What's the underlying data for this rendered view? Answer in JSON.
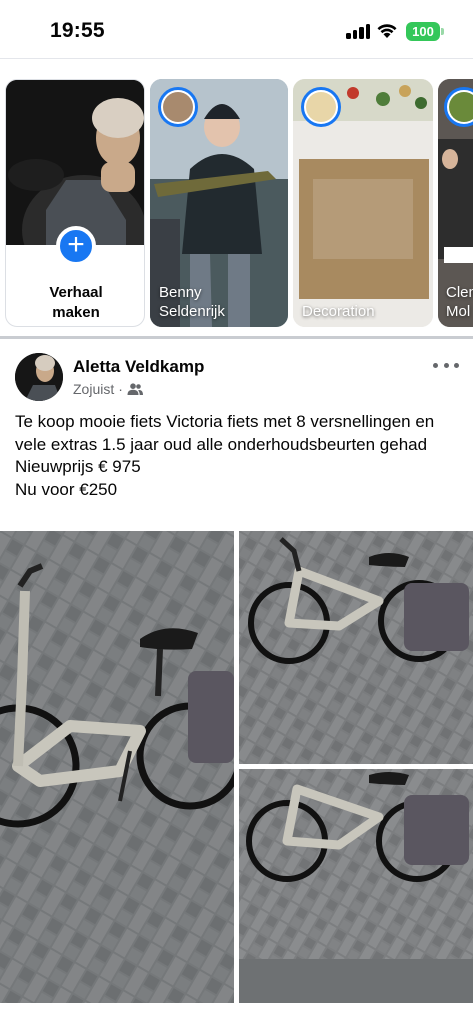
{
  "status_bar": {
    "time": "19:55",
    "battery": "100",
    "icons": [
      "signal-icon",
      "wifi-icon",
      "battery-icon"
    ]
  },
  "stories": {
    "create": {
      "label": "Verhaal\nmaken",
      "icon": "plus-icon"
    },
    "items": [
      {
        "name": "Benny\nSeldenrijk"
      },
      {
        "name": "Decoration"
      },
      {
        "name": "Clem\nMol"
      }
    ]
  },
  "post": {
    "author": "Aletta Veldkamp",
    "time": "Zojuist",
    "separator": "·",
    "audience_icon": "friends-icon",
    "text": "Te koop mooie fiets Victoria fiets met 8 versnellingen en vele extras 1.5 jaar oud alle onderhoudsbeurten gehad\nNieuwprijs € 975\nNu voor €250",
    "more_icon": "more-horizontal-icon"
  },
  "colors": {
    "accent": "#1877f2",
    "battery": "#34c759",
    "secondary_text": "#65676b"
  }
}
